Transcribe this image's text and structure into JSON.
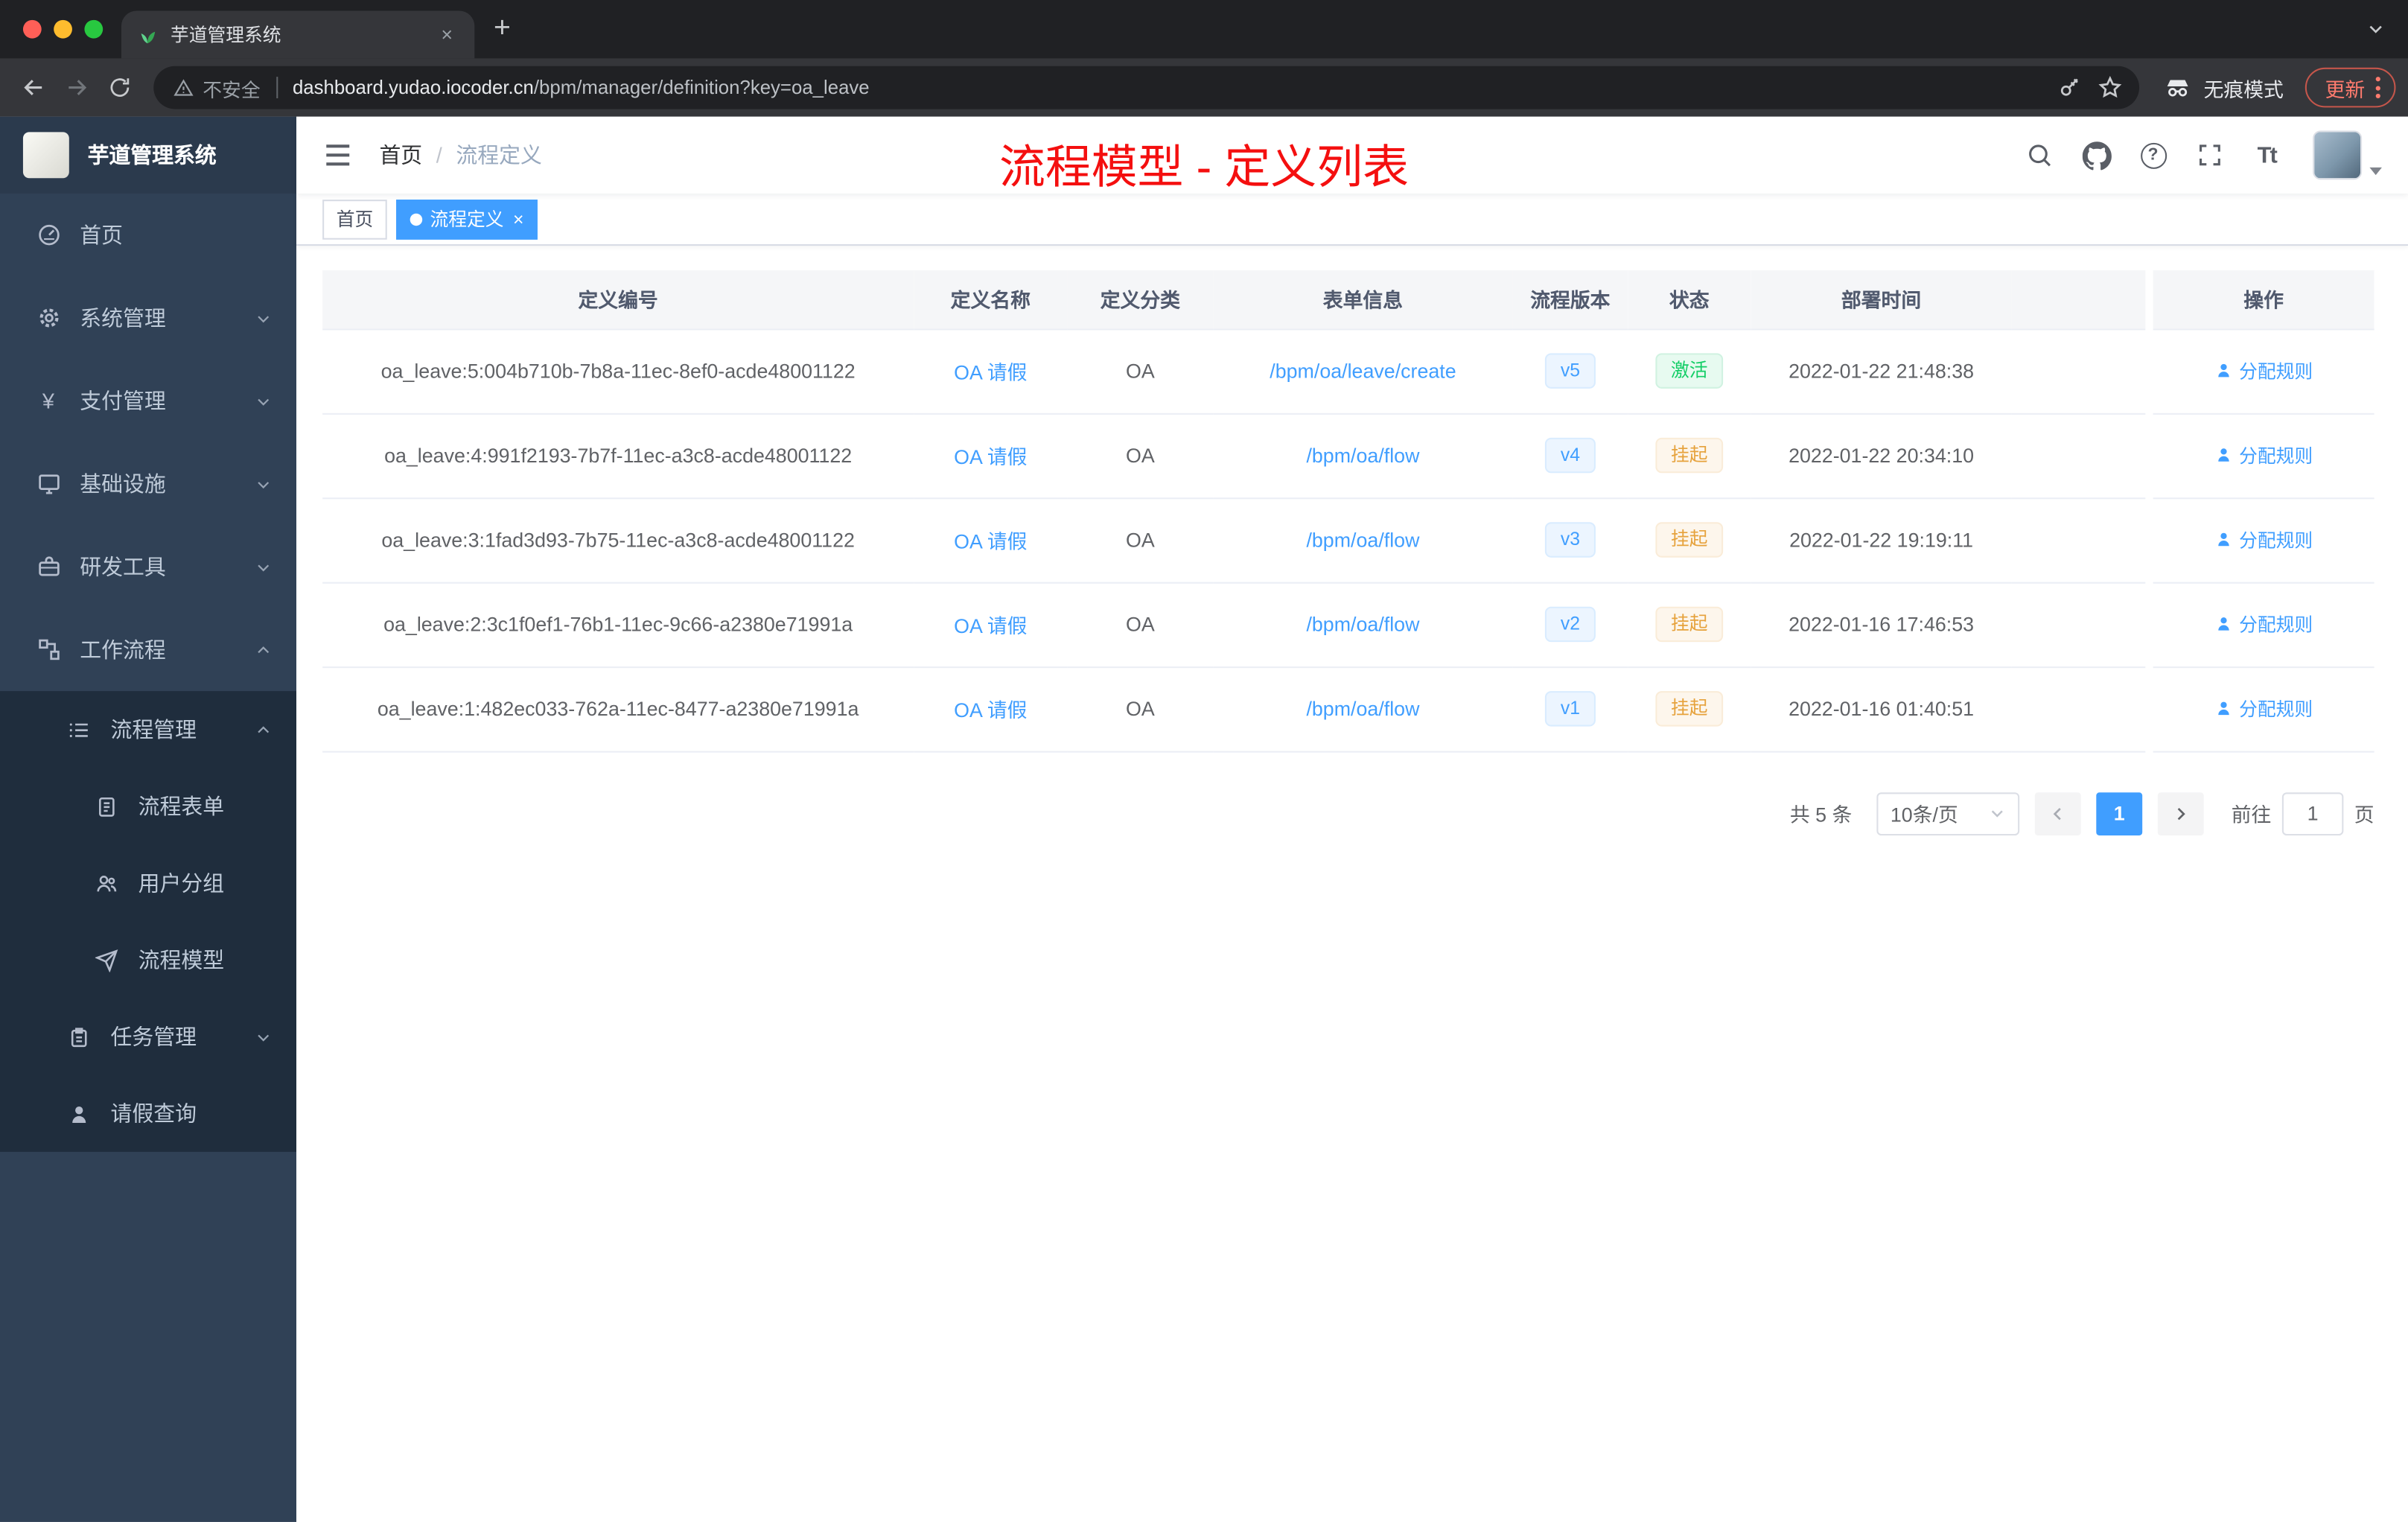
{
  "colors": {
    "accent": "#409eff",
    "success": "#13ce66",
    "warning": "#e6a23c",
    "annotation_red": "#f40f0f",
    "sidebar_bg": "#304156",
    "sidebar_submenu_bg": "#1f2d3d"
  },
  "browser": {
    "tab_title": "芋道管理系统",
    "security_label": "不安全",
    "url_host": "dashboard.yudao.iocoder.cn",
    "url_path": "/bpm/manager/definition?key=oa_leave",
    "incognito_label": "无痕模式",
    "update_label": "更新"
  },
  "icons": {
    "close": "×",
    "plus": "+",
    "question": "?",
    "font_size": "Tt",
    "yen": "¥"
  },
  "sidebar": {
    "logo_title": "芋道管理系统",
    "menu": [
      {
        "label": "首页"
      },
      {
        "label": "系统管理"
      },
      {
        "label": "支付管理"
      },
      {
        "label": "基础设施"
      },
      {
        "label": "研发工具"
      },
      {
        "label": "工作流程"
      },
      {
        "label": "流程管理"
      },
      {
        "label": "流程表单"
      },
      {
        "label": "用户分组"
      },
      {
        "label": "流程模型"
      },
      {
        "label": "任务管理"
      },
      {
        "label": "请假查询"
      }
    ]
  },
  "navbar": {
    "breadcrumb_home": "首页",
    "breadcrumb_separator": "/",
    "breadcrumb_current": "流程定义",
    "annotation": "流程模型 - 定义列表"
  },
  "tags": {
    "items": [
      {
        "label": "首页"
      },
      {
        "label": "流程定义"
      }
    ]
  },
  "table": {
    "headers": [
      "定义编号",
      "定义名称",
      "定义分类",
      "表单信息",
      "流程版本",
      "状态",
      "部署时间",
      "操作"
    ],
    "rows": [
      {
        "id": "oa_leave:5:004b710b-7b8a-11ec-8ef0-acde48001122",
        "name": "OA 请假",
        "category": "OA",
        "form": "/bpm/oa/leave/create",
        "version": "v5",
        "status": "激活",
        "time": "2022-01-22 21:48:38",
        "action": "分配规则"
      },
      {
        "id": "oa_leave:4:991f2193-7b7f-11ec-a3c8-acde48001122",
        "name": "OA 请假",
        "category": "OA",
        "form": "/bpm/oa/flow",
        "version": "v4",
        "status": "挂起",
        "time": "2022-01-22 20:34:10",
        "action": "分配规则"
      },
      {
        "id": "oa_leave:3:1fad3d93-7b75-11ec-a3c8-acde48001122",
        "name": "OA 请假",
        "category": "OA",
        "form": "/bpm/oa/flow",
        "version": "v3",
        "status": "挂起",
        "time": "2022-01-22 19:19:11",
        "action": "分配规则"
      },
      {
        "id": "oa_leave:2:3c1f0ef1-76b1-11ec-9c66-a2380e71991a",
        "name": "OA 请假",
        "category": "OA",
        "form": "/bpm/oa/flow",
        "version": "v2",
        "status": "挂起",
        "time": "2022-01-16 17:46:53",
        "action": "分配规则"
      },
      {
        "id": "oa_leave:1:482ec033-762a-11ec-8477-a2380e71991a",
        "name": "OA 请假",
        "category": "OA",
        "form": "/bpm/oa/flow",
        "version": "v1",
        "status": "挂起",
        "time": "2022-01-16 01:40:51",
        "action": "分配规则"
      }
    ]
  },
  "pagination": {
    "total": "共 5 条",
    "page_size": "10条/页",
    "current_page": "1",
    "goto_label": "前往",
    "goto_value": "1",
    "page_unit": "页"
  }
}
